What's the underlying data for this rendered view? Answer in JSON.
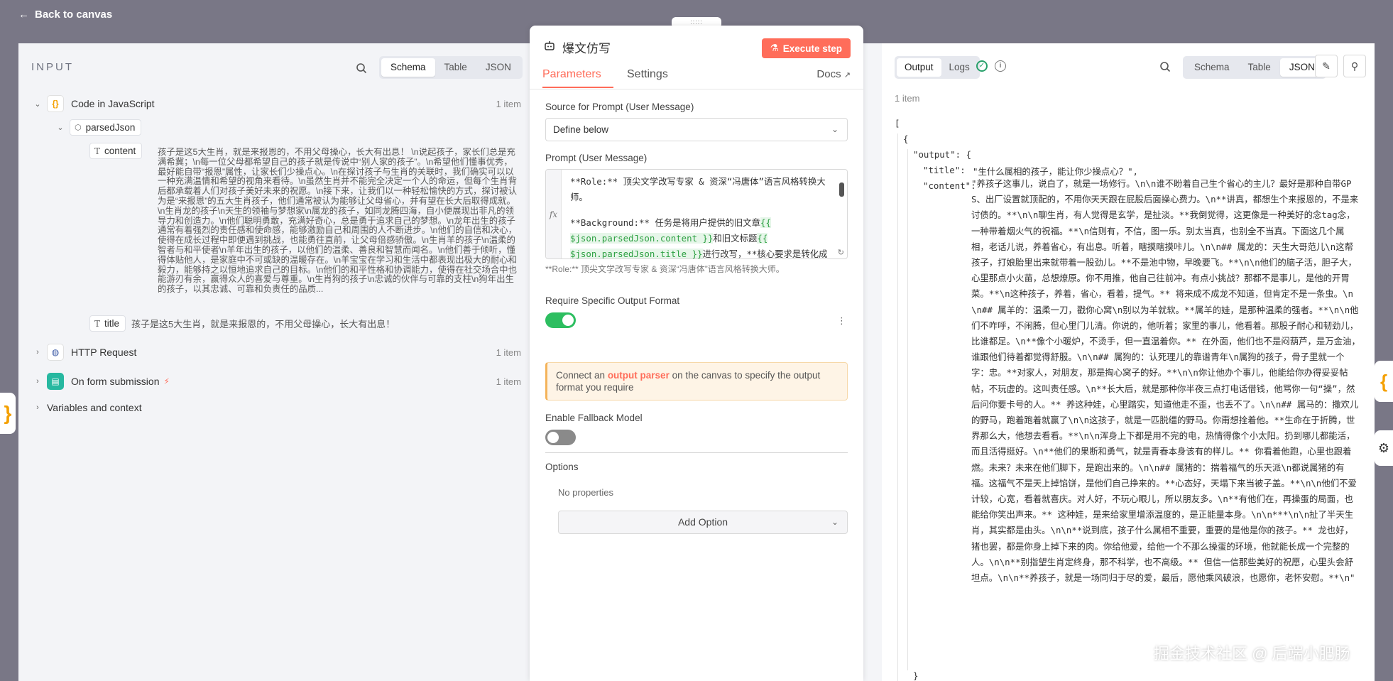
{
  "nav": {
    "back_label": "Back to canvas"
  },
  "input": {
    "title": "INPUT",
    "views": [
      "Schema",
      "Table",
      "JSON"
    ],
    "active_view": "Schema",
    "nodes": [
      {
        "name": "Code in JavaScript",
        "count": "1 item",
        "icon": "code-braces-icon"
      },
      {
        "name": "HTTP Request",
        "count": "1 item",
        "icon": "globe-icon"
      },
      {
        "name": "On form submission",
        "count": "1 item",
        "icon": "form-icon"
      }
    ],
    "variables_label": "Variables and context",
    "parsed_field": "parsedJson",
    "content_key": "content",
    "content_value": "孩子是这5大生肖，就是来报恩的，不用父母操心，长大有出息！ \\n说起孩子，家长们总是充满希冀；\\n每一位父母都希望自己的孩子就是传说中“别人家的孩子”。\\n希望他们懂事优秀，最好能自带“报恩”属性，让家长们少操点心。\\n在探讨孩子与生肖的关联时，我们确实可以以一种充满温情和希望的视角来看待。\\n虽然生肖并不能完全决定一个人的命运，但每个生肖背后都承载着人们对孩子美好未来的祝愿。\\n接下来，让我们以一种轻松愉快的方式，探讨被认为是“来报恩”的五大生肖孩子，他们通常被认为能够让父母省心，并有望在长大后取得成就。\\n生肖龙的孩子\\n天生的领袖与梦想家\\n属龙的孩子，如同龙腾四海，自小便展现出非凡的领导力和创造力。\\n他们聪明勇敢，充满好奇心，总是勇于追求自己的梦想。\\n龙年出生的孩子通常有着强烈的责任感和使命感，能够激励自己和周围的人不断进步。\\n他们的自信和决心，使得在成长过程中即便遇到挑战，也能勇往直前，让父母倍感骄傲。\\n生肖羊的孩子\\n温柔的智者与和平使者\\n羊年出生的孩子，以他们的温柔、善良和智慧而闻名。\\n他们善于倾听，懂得体贴他人，是家庭中不可或缺的温暖存在。\\n羊宝宝在学习和生活中都表现出极大的耐心和毅力，能够持之以恒地追求自己的目标。\\n他们的和平性格和协调能力，使得在社交场合中也能游刃有余，赢得众人的喜爱与尊重。\\n生肖狗的孩子\\n忠诚的伙伴与可靠的支柱\\n狗年出生的孩子，以其忠诚、可靠和负责任的品质...",
    "title_key": "title",
    "title_value": "孩子是这5大生肖，就是来报恩的，不用父母操心，长大有出息！"
  },
  "node": {
    "title": "爆文仿写",
    "execute_label": "Execute step",
    "tabs": [
      "Parameters",
      "Settings"
    ],
    "docs_label": "Docs",
    "source_label": "Source for Prompt (User Message)",
    "source_value": "Define below",
    "prompt_label": "Prompt (User Message)",
    "prompt_line1": "**Role:** 顶尖文学改写专家 & 资深“冯唐体”语言风格转换大师。",
    "prompt_line2a": "**Background:** 任务是将用户提供的旧文章",
    "prompt_expr1": "{{ $json.parsedJson.content }}",
    "prompt_line2b": "和旧文标题",
    "prompt_expr2": "{{ $json.parsedJson.title }}",
    "prompt_line2c": "进行改写，**核心要求是转化成冯唐（“大白话",
    "prompt_preview": "**Role:**  顶尖文学改写专家  &  资深“冯唐体”语言风格转换大师。",
    "require_label": "Require Specific Output Format",
    "require_on": true,
    "notice_pre": "Connect an ",
    "notice_link": "output parser",
    "notice_post": " on the canvas to specify the output format you require",
    "fallback_label": "Enable Fallback Model",
    "fallback_on": false,
    "options_label": "Options",
    "no_props": "No properties",
    "add_option": "Add Option"
  },
  "output": {
    "views_left": [
      "Output",
      "Logs"
    ],
    "views": [
      "Schema",
      "Table",
      "JSON"
    ],
    "active_view": "JSON",
    "item_count": "1 item",
    "json_key_output": "\"output\": {",
    "json_key_title": "\"title\":",
    "json_title_value": "\"生什么属相的孩子，能让你少操点心？\",",
    "json_key_content": "\"content\":",
    "json_content_value": "\"养孩子这事儿，说白了，就是一场修行。\\n\\n谁不盼着自己生个省心的主儿？最好是那种自带GPS、出厂设置就顶配的，不用你天天跟在屁股后面操心费力。\\n**讲真，都想生个来报恩的，不是来讨债的。**\\n\\n聊生肖，有人觉得是玄学，是扯淡。**我倒觉得，这更像是一种美好的念tag念，一种带着烟火气的祝福。**\\n信则有，不信，图一乐。别太当真，也别全不当真。下面这几个属相，老话儿说，养着省心，有出息。听着，瞎摸瞎摸咔儿。\\n\\n## 属龙的：天生大哥范儿\\n这帮孩子，打娘胎里出来就带着一股劲儿。**不是池中物，早晚要飞。**\\n\\n他们的脑子活，胆子大，心里那点小火苗，总想燎原。你不用推，他自己往前冲。有点小挑战？那都不是事儿，是他的开胃菜。**\\n这种孩子，养着，省心，看着，提气。** 将来成不成龙不知道，但肯定不是一条虫。\\n\\n## 属羊的：温柔一刀，戳你心窝\\n别以为羊就软。**属羊的娃，是那种温柔的强者。**\\n\\n他们不咋呼，不闹腾，但心里门儿清。你说的，他听着；家里的事儿，他看着。那股子耐心和韧劲儿，比谁都足。\\n**像个小暖炉，不烫手，但一直温着你。** 在外面，他们也不是闷葫芦，是万金油，谁跟他们待着都觉得舒服。\\n\\n## 属狗的：认死理儿的靠谱青年\\n属狗的孩子，骨子里就一个字：忠。**对家人，对朋友，那是掏心窝子的好。**\\n\\n你让他办个事儿，他能给你办得妥妥帖帖，不玩虚的。这叫责任感。\\n**长大后，就是那种你半夜三点打电话借钱，他骂你一句“操”，然后问你要卡号的人。** 养这种娃，心里踏实，知道他走不歪，也丢不了。\\n\\n## 属马的：撒欢儿的野马，跑着跑着就赢了\\n\\n这孩子，就是一匹脱缰的野马。你甭想拴着他。**生命在于折腾，世界那么大，他想去看看。**\\n\\n浑身上下都是用不完的电，热情得像个小太阳。扔到哪儿都能活，而且活得挺好。\\n**他们的果断和勇气，就是青春本身该有的样儿。** 你看着他跑，心里也跟着燃。未来？未来在他们脚下，是跑出来的。\\n\\n## 属猪的：揣着福气的乐天派\\n都说属猪的有福。这福气不是天上掉馅饼，是他们自己挣来的。**心态好，天塌下来当被子盖。**\\n\\n他们不爱计较，心宽，看着就喜庆。对人好，不玩心眼儿，所以朋友多。\\n**有他们在，再操蛋的局面，也能给你笑出声来。** 这种娃，是来给家里增添温度的，是正能量本身。\\n\\n***\\n\\n扯了半天生肖，其实都是由头。\\n\\n**说到底，孩子什么属相不重要，重要的是他是你的孩子。** 龙也好，猪也罢，都是你身上掉下来的肉。你给他爱，给他一个不那么操蛋的环境，他就能长成一个完整的人。\\n\\n**别指望生肖定终身，那不科学，也不高级。** 但信一信那些美好的祝愿，心里头会舒坦点。\\n\\n**养孩子，就是一场同归于尽的爱，最后，愿他乘风破浪，也愿你，老怀安慰。**\\n\""
  },
  "watermark": "掘金技术社区 @ 后端小肥肠",
  "colors": {
    "accent": "#ff6d5a",
    "success": "#29a16b",
    "toggle_on": "#2dbe60",
    "toggle_off": "#8a8a8a"
  }
}
